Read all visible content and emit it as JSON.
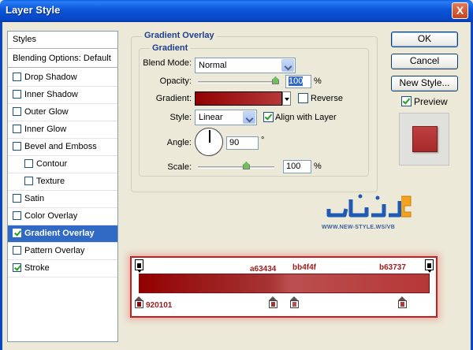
{
  "window": {
    "title": "Layer Style",
    "close_glyph": "X"
  },
  "styles_panel": {
    "header": "Styles",
    "blending": "Blending Options: Default",
    "items": [
      {
        "label": "Drop Shadow",
        "checked": false,
        "indent": false
      },
      {
        "label": "Inner Shadow",
        "checked": false,
        "indent": false
      },
      {
        "label": "Outer Glow",
        "checked": false,
        "indent": false
      },
      {
        "label": "Inner Glow",
        "checked": false,
        "indent": false
      },
      {
        "label": "Bevel and Emboss",
        "checked": false,
        "indent": false
      },
      {
        "label": "Contour",
        "checked": false,
        "indent": true
      },
      {
        "label": "Texture",
        "checked": false,
        "indent": true
      },
      {
        "label": "Satin",
        "checked": false,
        "indent": false
      },
      {
        "label": "Color Overlay",
        "checked": false,
        "indent": false
      },
      {
        "label": "Gradient Overlay",
        "checked": true,
        "indent": false,
        "selected": true
      },
      {
        "label": "Pattern Overlay",
        "checked": false,
        "indent": false
      },
      {
        "label": "Stroke",
        "checked": true,
        "indent": false
      }
    ]
  },
  "gradient_overlay": {
    "section_title": "Gradient Overlay",
    "subsection_title": "Gradient",
    "blend_mode_label": "Blend Mode:",
    "blend_mode": "Normal",
    "opacity_label": "Opacity:",
    "opacity": "100",
    "opacity_unit": "%",
    "gradient_label": "Gradient:",
    "reverse_label": "Reverse",
    "reverse_checked": false,
    "style_label": "Style:",
    "style": "Linear",
    "align_label": "Align with Layer",
    "align_checked": true,
    "angle_label": "Angle:",
    "angle": "90",
    "angle_unit": "°",
    "scale_label": "Scale:",
    "scale": "100",
    "scale_unit": "%"
  },
  "buttons": {
    "ok": "OK",
    "cancel": "Cancel",
    "new_style": "New Style...",
    "preview_label": "Preview"
  },
  "preview": {
    "checked": true
  },
  "logo": {
    "url_text": "WWW.NEW-STYLE.WS/VB"
  },
  "gradient_editor": {
    "colors": {
      "start": "#920101",
      "mid1": "#a63434",
      "mid2": "#bb4f4f",
      "end": "#b63737"
    },
    "labels": {
      "start": "920101",
      "mid1": "a63434",
      "mid2": "bb4f4f",
      "end": "b63737"
    }
  }
}
